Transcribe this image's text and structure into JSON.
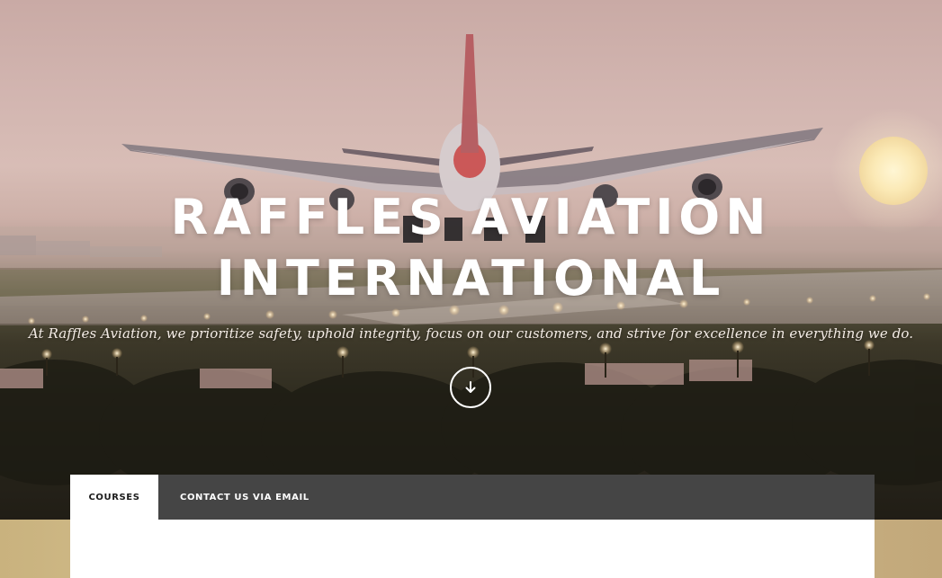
{
  "hero": {
    "title_line1": "RAFFLES AVIATION",
    "title_line2": "INTERNATIONAL",
    "tagline": "At Raffles Aviation, we prioritize safety, uphold integrity, focus on our customers, and strive for excellence in everything we do.",
    "scroll_icon": "arrow-down-circle-icon"
  },
  "tabs": [
    {
      "label": "COURSES",
      "active": true
    },
    {
      "label": "CONTACT US VIA EMAIL",
      "active": false
    }
  ],
  "colors": {
    "tab_bar": "#454545",
    "tab_active": "#ffffff",
    "sky": "#d2b5b0",
    "sun": "#fff2c8"
  }
}
